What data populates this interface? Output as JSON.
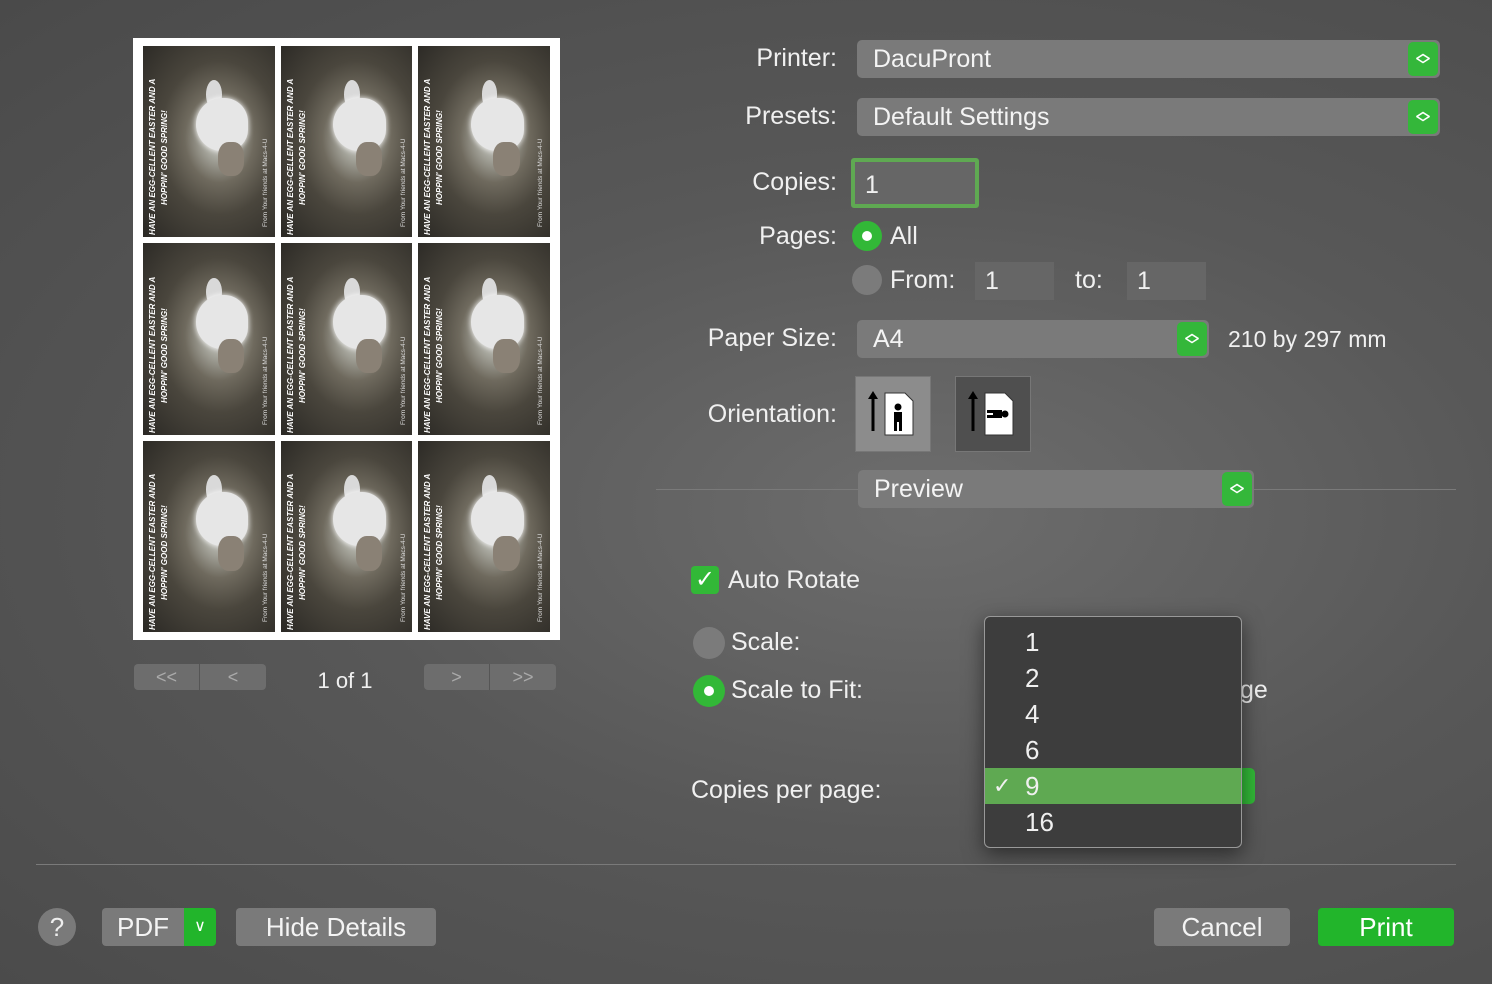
{
  "preview": {
    "tile_text_main": "HAVE AN EGG-CELLENT EASTER AND A",
    "tile_text_sub": "HOPPIN' GOOD SPRING!",
    "tile_text_credit": "From Your friends at Macs-4-U",
    "nav_first": "<<",
    "nav_prev": "<",
    "nav_next": ">",
    "nav_last": ">>",
    "page_indicator": "1 of 1"
  },
  "printer": {
    "label": "Printer:",
    "value": "DacuPront"
  },
  "presets": {
    "label": "Presets:",
    "value": "Default Settings"
  },
  "copies": {
    "label": "Copies:",
    "value": "1"
  },
  "pages": {
    "label": "Pages:",
    "all_label": "All",
    "from_label": "From:",
    "from_value": "1",
    "to_label": "to:",
    "to_value": "1",
    "selected": "All"
  },
  "paper_size": {
    "label": "Paper Size:",
    "value": "A4",
    "dimensions": "210 by 297 mm"
  },
  "orientation": {
    "label": "Orientation:",
    "selected": "portrait"
  },
  "section_menu": {
    "value": "Preview"
  },
  "auto_rotate": {
    "label": "Auto Rotate",
    "checked": true
  },
  "scale": {
    "label": "Scale:"
  },
  "scale_to_fit": {
    "label": "Scale to Fit:",
    "partial_text": "ge"
  },
  "copies_per_page": {
    "label": "Copies per page:",
    "options": [
      "1",
      "2",
      "4",
      "6",
      "9",
      "16"
    ],
    "selected": "9"
  },
  "footer": {
    "help": "?",
    "pdf": "PDF",
    "hide_details": "Hide Details",
    "cancel": "Cancel",
    "print": "Print"
  },
  "colors": {
    "accent": "#32b837",
    "menu_highlight": "#5fa952"
  }
}
